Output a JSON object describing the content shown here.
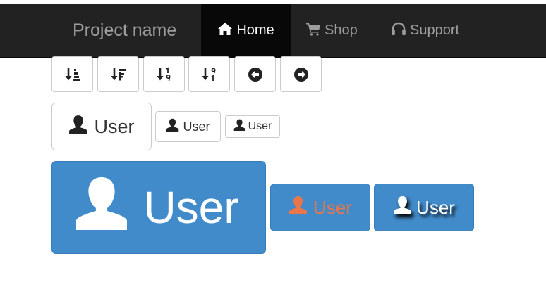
{
  "navbar": {
    "brand": "Project name",
    "items": [
      {
        "label": "Home",
        "icon": "home-icon",
        "active": true
      },
      {
        "label": "Shop",
        "icon": "shopping-cart-icon",
        "active": false
      },
      {
        "label": "Support",
        "icon": "headphones-icon",
        "active": false
      }
    ]
  },
  "toolbar": {
    "buttons": [
      {
        "icon": "sort-by-attributes-icon"
      },
      {
        "icon": "sort-by-alphabet-icon"
      },
      {
        "icon": "sort-by-order-icon"
      },
      {
        "icon": "sort-by-order-alt-icon"
      },
      {
        "icon": "circle-arrow-left-icon"
      },
      {
        "icon": "circle-arrow-right-icon"
      }
    ]
  },
  "user_buttons": {
    "large": "User",
    "medium": "User",
    "small": "User",
    "primary_xl": "User",
    "primary_orange": "User",
    "primary_shadow": "User"
  },
  "colors": {
    "navbar_bg": "#222222",
    "navbar_active_bg": "#080808",
    "navbar_text": "#9d9d9d",
    "primary": "#428bca",
    "orange_text": "#e8764a"
  }
}
